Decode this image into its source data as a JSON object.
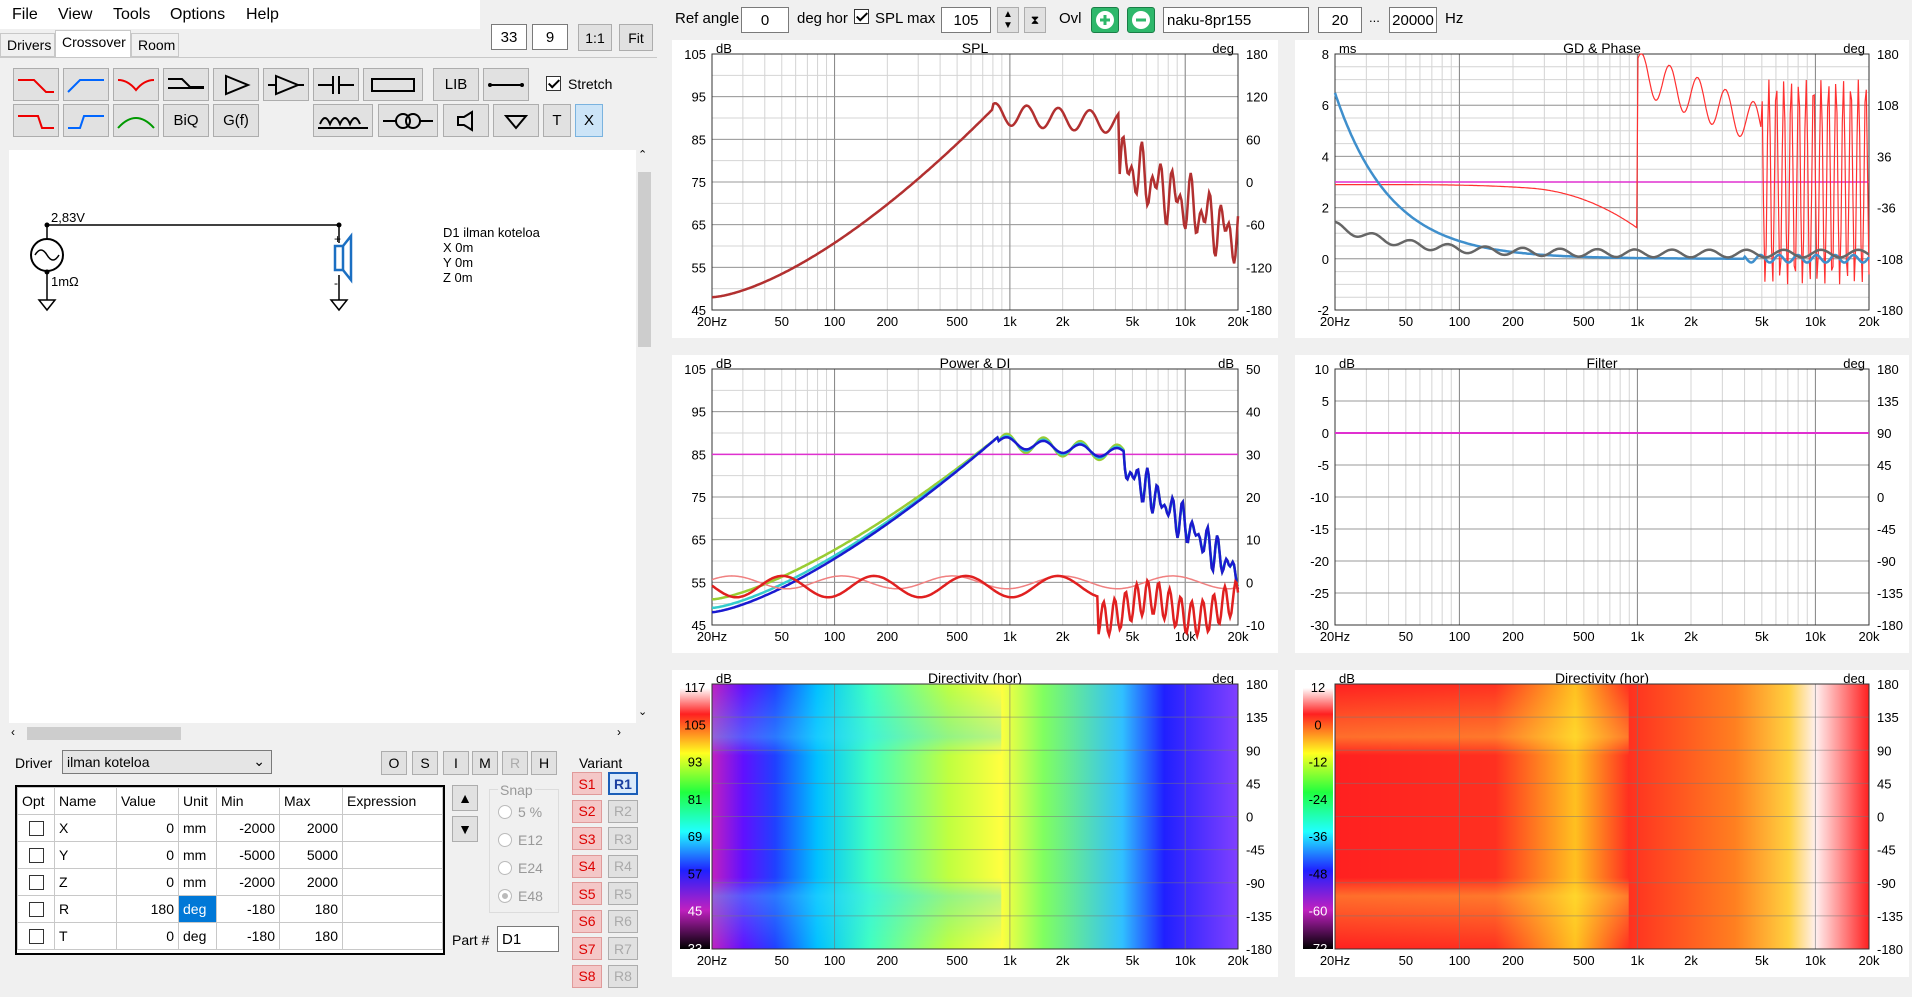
{
  "menu": [
    "File",
    "View",
    "Tools",
    "Options",
    "Help"
  ],
  "tabs": [
    "Drivers",
    "Crossover",
    "Room"
  ],
  "view_controls": {
    "v1": "33",
    "v2": "9",
    "ratio": "1:1",
    "fit": "Fit"
  },
  "toolbar": {
    "lib": "LIB",
    "biq": "BiQ",
    "gf": "G(f)",
    "t": "T",
    "x": "X",
    "stretch": "Stretch"
  },
  "top": {
    "ref_angle_label": "Ref angle",
    "ref_angle": "0",
    "deg_hor": "deg hor",
    "spl_max_label": "SPL max",
    "spl_max": "105",
    "ovl": "Ovl",
    "preset": "naku-8pr155",
    "f_lo": "20",
    "ellipsis": "...",
    "f_hi": "20000",
    "hz": "Hz"
  },
  "schematic": {
    "voltage": "2,83V",
    "resistance": "1mΩ",
    "driver": "D1 ilman koteloa",
    "x": "X 0m",
    "y": "Y 0m",
    "z": "Z 0m",
    "plus": "+",
    "minus": "-"
  },
  "driver_select": {
    "label": "Driver",
    "value": "ilman koteloa"
  },
  "osim": [
    "O",
    "S",
    "I",
    "M",
    "R",
    "H"
  ],
  "grid": {
    "headers": [
      "Opt",
      "Name",
      "Value",
      "Unit",
      "Min",
      "Max",
      "Expression"
    ],
    "rows": [
      [
        "X",
        "0",
        "mm",
        "-2000",
        "2000"
      ],
      [
        "Y",
        "0",
        "mm",
        "-5000",
        "5000"
      ],
      [
        "Z",
        "0",
        "mm",
        "-2000",
        "2000"
      ],
      [
        "R",
        "180",
        "deg",
        "-180",
        "180"
      ],
      [
        "T",
        "0",
        "deg",
        "-180",
        "180"
      ]
    ]
  },
  "snap": {
    "label": "Snap",
    "options": [
      "5 %",
      "E12",
      "E24",
      "E48"
    ]
  },
  "part": {
    "label": "Part #",
    "value": "D1"
  },
  "variant": {
    "label": "Variant",
    "s": [
      "S1",
      "S2",
      "S3",
      "S4",
      "S5",
      "S6",
      "S7",
      "S8"
    ],
    "r": [
      "R1",
      "R2",
      "R3",
      "R4",
      "R5",
      "R6",
      "R7",
      "R8"
    ]
  },
  "xticks": [
    "20Hz",
    "50",
    "100",
    "200",
    "500",
    "1k",
    "2k",
    "5k",
    "10k",
    "20k"
  ],
  "charts": {
    "spl": {
      "title": "SPL",
      "lu": "dB",
      "ru": "deg",
      "left": [
        "105",
        "95",
        "85",
        "75",
        "65",
        "55",
        "45"
      ],
      "right": [
        "180",
        "120",
        "60",
        "0",
        "-60",
        "-120",
        "-180"
      ]
    },
    "gd": {
      "title": "GD & Phase",
      "lu": "ms",
      "ru": "deg",
      "left": [
        "8",
        "6",
        "4",
        "2",
        "0",
        "-2"
      ],
      "right": [
        "180",
        "108",
        "36",
        "-36",
        "-108",
        "-180"
      ]
    },
    "pow": {
      "title": "Power & DI",
      "lu": "dB",
      "ru": "dB",
      "left": [
        "105",
        "95",
        "85",
        "75",
        "65",
        "55",
        "45"
      ],
      "right": [
        "50",
        "40",
        "30",
        "20",
        "10",
        "0",
        "-10"
      ]
    },
    "filter": {
      "title": "Filter",
      "lu": "dB",
      "ru": "deg",
      "left": [
        "10",
        "5",
        "0",
        "-5",
        "-10",
        "-15",
        "-20",
        "-25",
        "-30"
      ],
      "right": [
        "180",
        "135",
        "90",
        "45",
        "0",
        "-45",
        "-90",
        "-135",
        "-180"
      ]
    },
    "dir1": {
      "title": "Directivity (hor)",
      "lu": "dB",
      "ru": "deg",
      "scale": [
        "117",
        "105",
        "93",
        "81",
        "69",
        "57",
        "45",
        "33"
      ],
      "right": [
        "180",
        "135",
        "90",
        "45",
        "0",
        "-45",
        "-90",
        "-135",
        "-180"
      ]
    },
    "dir2": {
      "title": "Directivity (hor)",
      "lu": "dB",
      "ru": "deg",
      "scale": [
        "12",
        "0",
        "-12",
        "-24",
        "-36",
        "-48",
        "-60",
        "-72"
      ],
      "right": [
        "180",
        "135",
        "90",
        "45",
        "0",
        "-45",
        "-90",
        "-135",
        "-180"
      ]
    }
  }
}
